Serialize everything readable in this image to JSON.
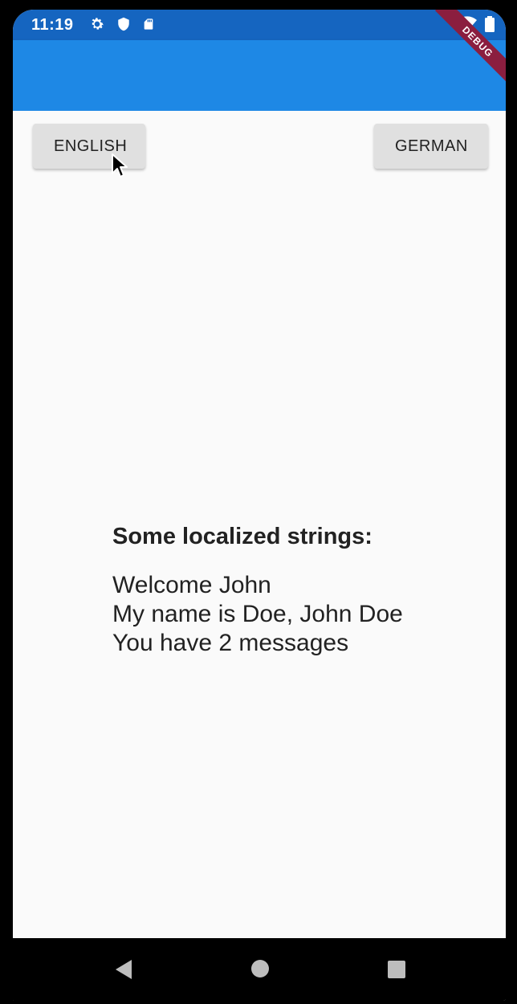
{
  "status_bar": {
    "time": "11:19",
    "left_icons": [
      "gear-icon",
      "shield-icon",
      "sd-card-icon"
    ],
    "right_icons": [
      "wifi-icon",
      "battery-icon"
    ]
  },
  "debug_banner": "DEBUG",
  "buttons": {
    "english_label": "ENGLISH",
    "german_label": "GERMAN"
  },
  "localized": {
    "heading": "Some localized strings:",
    "lines": [
      "Welcome John",
      "My name is Doe, John Doe",
      "You have 2 messages"
    ]
  },
  "colors": {
    "status_bar": "#1565c0",
    "app_bar": "#1e88e5",
    "background": "#fafafa",
    "button": "#e0e0e0",
    "debug_banner": "#8b1e3f"
  },
  "nav_bar": {
    "icons": [
      "back-icon",
      "home-icon",
      "recents-icon"
    ]
  }
}
